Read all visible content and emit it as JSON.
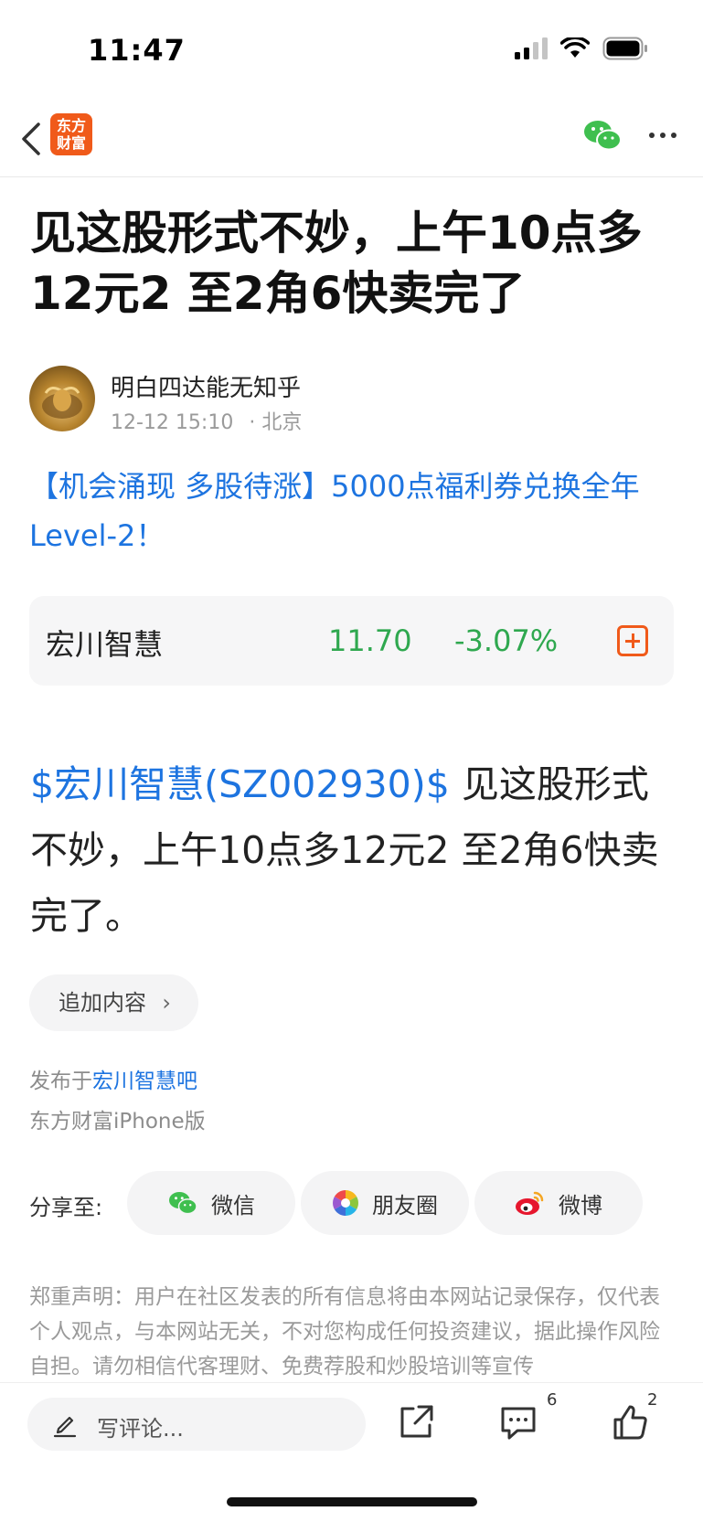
{
  "status_bar": {
    "time": "11:47"
  },
  "nav": {
    "logo_line1": "东方",
    "logo_line2": "财富"
  },
  "article": {
    "title": "见这股形式不妙，上午10点多12元2 至2角6快卖完了",
    "author": "明白四达能无知乎",
    "datetime": "12-12 15:10",
    "location": "· 北京",
    "promo": "【机会涌现 多股待涨】5000点福利券兑换全年Level-2！",
    "stock_tag": "$宏川智慧(SZ002930)$",
    "body": "  见这股形式不妙，上午10点多12元2 至2角6快卖完了。",
    "append_label": "追加内容",
    "published_prefix": "发布于",
    "published_bar": "宏川智慧吧",
    "source": "东方财富iPhone版",
    "disclaimer": "郑重声明：用户在社区发表的所有信息将由本网站记录保存，仅代表个人观点，与本网站无关，不对您构成任何投资建议，据此操作风险自担。请勿相信代客理财、免费荐股和炒股培训等宣传"
  },
  "stock_card": {
    "name": "宏川智慧",
    "price": "11.70",
    "change": "-3.07%",
    "change_color": "#2fa84f"
  },
  "share": {
    "label": "分享至:",
    "wechat": "微信",
    "moments": "朋友圈",
    "weibo": "微博"
  },
  "bottom": {
    "comment_placeholder": "写评论...",
    "comment_count": "6",
    "like_count": "2"
  },
  "colors": {
    "brand": "#f05a1a",
    "link": "#1d74e0",
    "down": "#2fa84f"
  }
}
